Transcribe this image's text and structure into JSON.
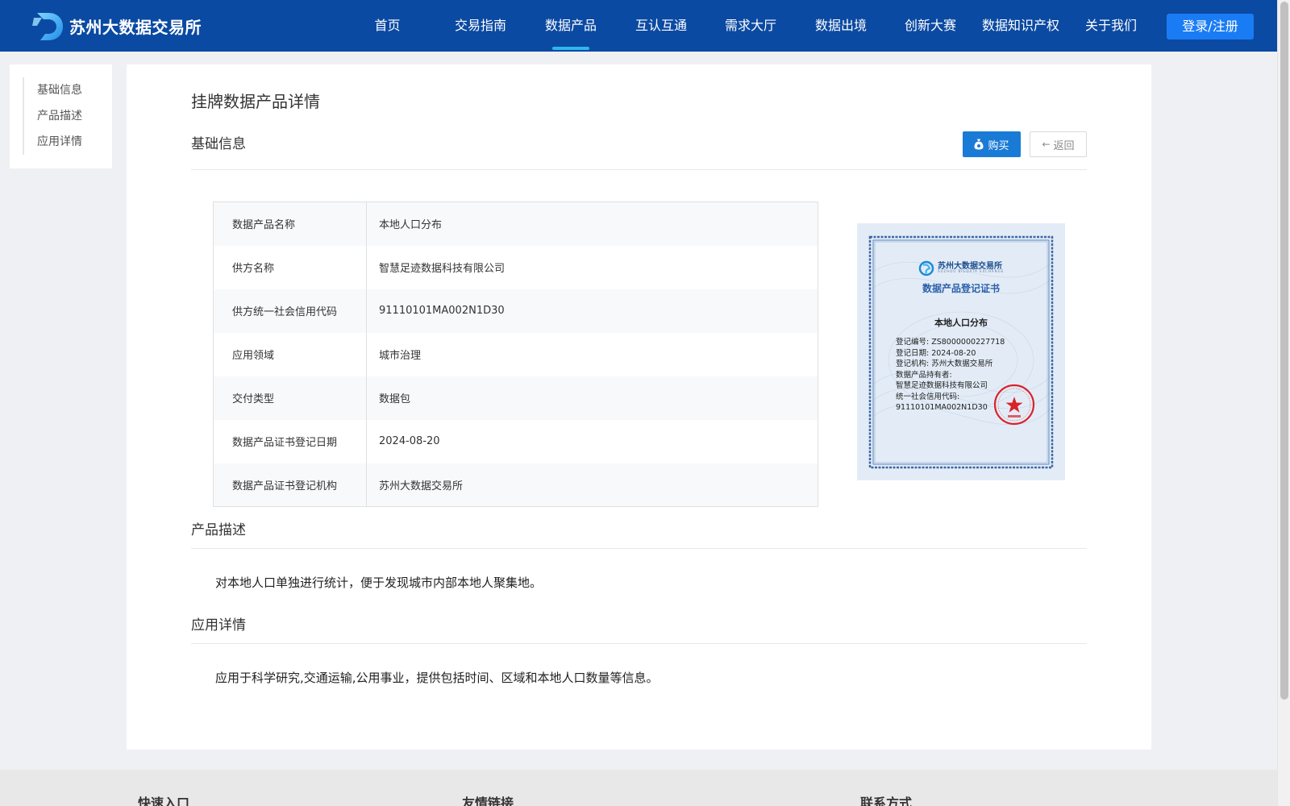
{
  "header": {
    "logo_text": "苏州大数据交易所",
    "nav": [
      "首页",
      "交易指南",
      "数据产品",
      "互认互通",
      "需求大厅",
      "数据出境",
      "创新大赛",
      "数据知识产权",
      "关于我们"
    ],
    "active_nav": "数据产品",
    "login_label": "登录/注册"
  },
  "sidenav": {
    "items": [
      "基础信息",
      "产品描述",
      "应用详情"
    ]
  },
  "page": {
    "title": "挂牌数据产品详情",
    "sections": {
      "basic": "基础信息",
      "description": "产品描述",
      "application": "应用详情"
    },
    "buy_label": "购买",
    "back_label": "返回"
  },
  "info": [
    {
      "key": "数据产品名称",
      "value": "本地人口分布"
    },
    {
      "key": "供方名称",
      "value": "智慧足迹数据科技有限公司"
    },
    {
      "key": "供方统一社会信用代码",
      "value": "91110101MA002N1D30"
    },
    {
      "key": "应用领域",
      "value": "城市治理"
    },
    {
      "key": "交付类型",
      "value": "数据包"
    },
    {
      "key": "数据产品证书登记日期",
      "value": "2024-08-20"
    },
    {
      "key": "数据产品证书登记机构",
      "value": "苏州大数据交易所"
    }
  ],
  "certificate": {
    "org": "苏州大数据交易所",
    "org_en": "SUZHOU BIGDATA EXCHANGE",
    "title": "数据产品登记证书",
    "product": "本地人口分布",
    "lines": [
      "登记编号: ZS8000000227718",
      "登记日期: 2024-08-20",
      "登记机构: 苏州大数据交易所",
      "数据产品持有者:",
      "智慧足迹数据科技有限公司",
      "统一社会信用代码:",
      "91110101MA002N1D30"
    ]
  },
  "description_text": "对本地人口单独进行统计，便于发现城市内部本地人聚集地。",
  "application_text": "应用于科学研究,交通运输,公用事业，提供包括时间、区域和本地人口数量等信息。",
  "footer": {
    "titles": [
      "快速入口",
      "友情链接",
      "联系方式"
    ]
  },
  "colors": {
    "header_bg": "#0b4aa2",
    "active_underline": "#2fb6f0",
    "login_btn": "#1a7cf5",
    "buy_btn": "#1a7bd6",
    "seal_red": "#d8232a"
  }
}
